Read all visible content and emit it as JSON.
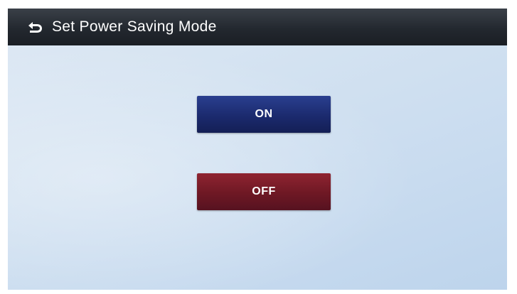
{
  "header": {
    "title": "Set Power Saving Mode",
    "back_icon": "back-arrow-icon"
  },
  "options": {
    "on_label": "ON",
    "off_label": "OFF"
  },
  "colors": {
    "title_bar": "#23282f",
    "background": "#d3e2f1",
    "on_button": "#1b2a6e",
    "off_button": "#6e1824",
    "text": "#ffffff"
  }
}
